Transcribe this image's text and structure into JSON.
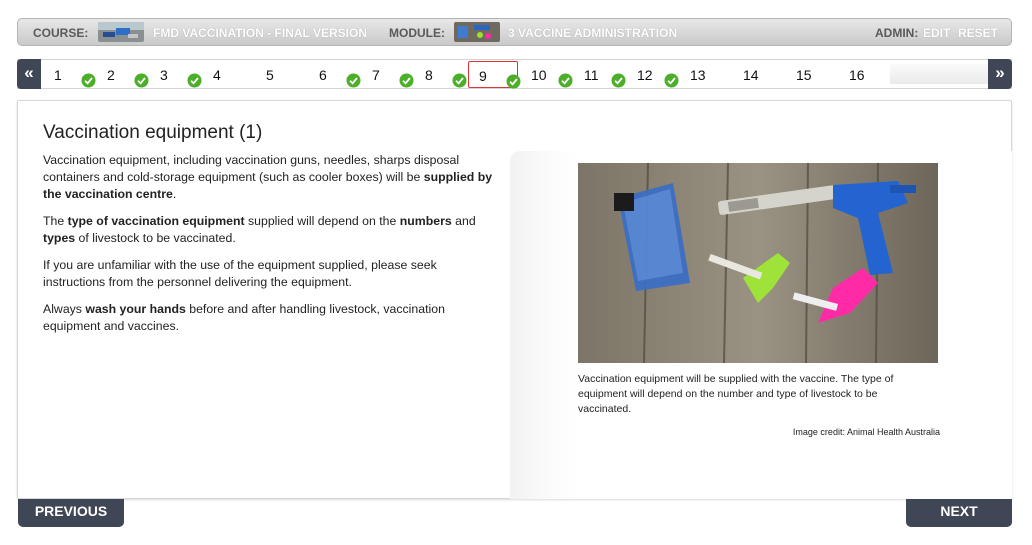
{
  "header": {
    "course_label": "COURSE:",
    "course_title": "FMD VACCINATION - FINAL VERSION",
    "module_label": "MODULE:",
    "module_title": "3 VACCINE ADMINISTRATION",
    "admin_label": "ADMIN:",
    "edit_label": "EDIT",
    "reset_label": "RESET"
  },
  "nav": {
    "prev_arrow": "«",
    "next_arrow": "»",
    "current_page": "9",
    "pages": [
      {
        "label": "1",
        "completed": true
      },
      {
        "label": "2",
        "completed": true
      },
      {
        "label": "3",
        "completed": true
      },
      {
        "label": "4",
        "completed": false
      },
      {
        "label": "5",
        "completed": false
      },
      {
        "label": "6",
        "completed": true
      },
      {
        "label": "7",
        "completed": true
      },
      {
        "label": "8",
        "completed": true
      },
      {
        "label": "9",
        "completed": true
      },
      {
        "label": "10",
        "completed": true
      },
      {
        "label": "11",
        "completed": true
      },
      {
        "label": "12",
        "completed": true
      },
      {
        "label": "13",
        "completed": false
      },
      {
        "label": "14",
        "completed": false
      },
      {
        "label": "15",
        "completed": false
      },
      {
        "label": "16",
        "completed": false
      }
    ]
  },
  "content": {
    "title": "Vaccination equipment (1)",
    "p1_a": "Vaccination equipment, including vaccination guns, needles, sharps disposal containers and cold-storage equipment (such as cooler boxes) will be ",
    "p1_b": "supplied by the vaccination centre",
    "p1_c": ".",
    "p2_a": "The ",
    "p2_b": "type of vaccination equipment",
    "p2_c": " supplied will depend on the ",
    "p2_d": "numbers",
    "p2_e": " and ",
    "p2_f": "types",
    "p2_g": " of livestock to be vaccinated.",
    "p3": "If you are unfamiliar with the use of the equipment supplied, please seek instructions from the personnel delivering the equipment.",
    "p4_a": "Always ",
    "p4_b": "wash your hands",
    "p4_c": " before and after handling livestock, vaccination equipment and vaccines.",
    "caption": "Vaccination equipment will be supplied with the vaccine. The type of equipment will depend on the number and type of livestock to be vaccinated.",
    "credit": "Image credit: Animal Health Australia"
  },
  "footer": {
    "previous_label": "PREVIOUS",
    "next_label": "NEXT"
  },
  "colors": {
    "dark_button": "#3f4656",
    "current_page_border": "#e0343a",
    "check_green": "#4caf2a"
  }
}
